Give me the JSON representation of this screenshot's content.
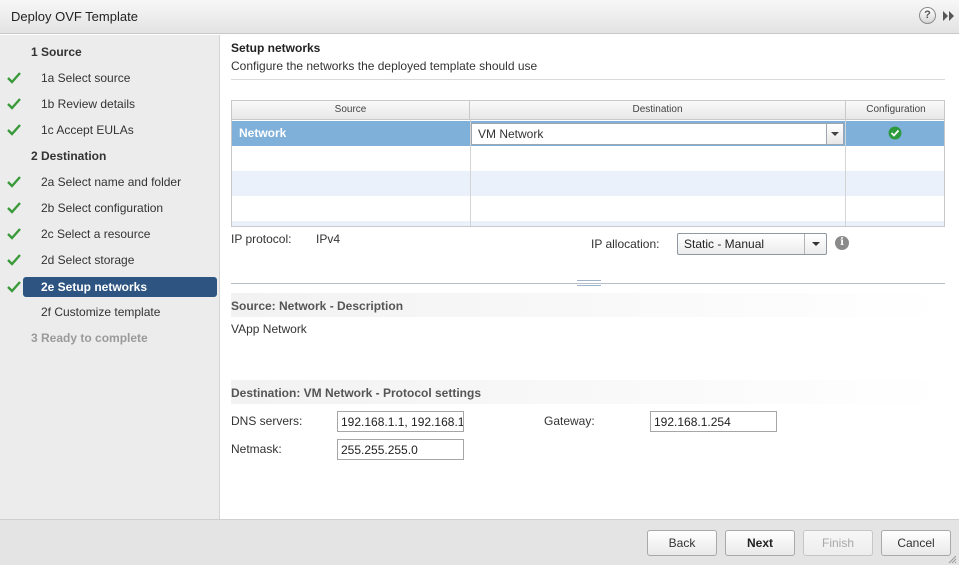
{
  "window": {
    "title": "Deploy OVF Template",
    "help_glyph": "?",
    "icons": [
      "help-icon",
      "collapse-icon"
    ]
  },
  "sidebar": {
    "items": [
      {
        "label": "1  Source",
        "kind": "section",
        "done": false
      },
      {
        "label": "1a  Select source",
        "kind": "step",
        "done": true
      },
      {
        "label": "1b  Review details",
        "kind": "step",
        "done": true
      },
      {
        "label": "1c  Accept EULAs",
        "kind": "step",
        "done": true
      },
      {
        "label": "2  Destination",
        "kind": "section",
        "done": false
      },
      {
        "label": "2a  Select name and folder",
        "kind": "step",
        "done": true
      },
      {
        "label": "2b  Select configuration",
        "kind": "step",
        "done": true
      },
      {
        "label": "2c  Select a resource",
        "kind": "step",
        "done": true
      },
      {
        "label": "2d  Select storage",
        "kind": "step",
        "done": true
      },
      {
        "label": "2e  Setup networks",
        "kind": "step",
        "done": true,
        "selected": true
      },
      {
        "label": "2f  Customize template",
        "kind": "step",
        "done": false
      },
      {
        "label": "3  Ready to complete",
        "kind": "disabled",
        "done": false
      }
    ],
    "check_color": "#3a9a3a",
    "selected_color": "#2e5482"
  },
  "main": {
    "heading": "Setup networks",
    "subheading": "Configure the networks the deployed template should use",
    "table": {
      "columns": [
        "Source",
        "Destination",
        "Configuration"
      ],
      "rows": [
        {
          "source": "Network",
          "destination": "VM Network",
          "configuration": "ok-icon",
          "selected": true
        }
      ]
    },
    "ip_protocol": {
      "label": "IP protocol:",
      "value": "IPv4"
    },
    "ip_allocation": {
      "label": "IP allocation:",
      "value": "Static - Manual",
      "info_glyph": "i"
    },
    "source_section": {
      "title": "Source: Network - Description",
      "description": "VApp Network"
    },
    "destination_section": {
      "title": "Destination: VM Network - Protocol settings",
      "dns_label": "DNS servers:",
      "dns_value": "192.168.1.1, 192.168.1",
      "netmask_label": "Netmask:",
      "netmask_value": "255.255.255.0",
      "gateway_label": "Gateway:",
      "gateway_value": "192.168.1.254"
    }
  },
  "footer": {
    "back": "Back",
    "next": "Next",
    "finish": "Finish",
    "cancel": "Cancel"
  }
}
